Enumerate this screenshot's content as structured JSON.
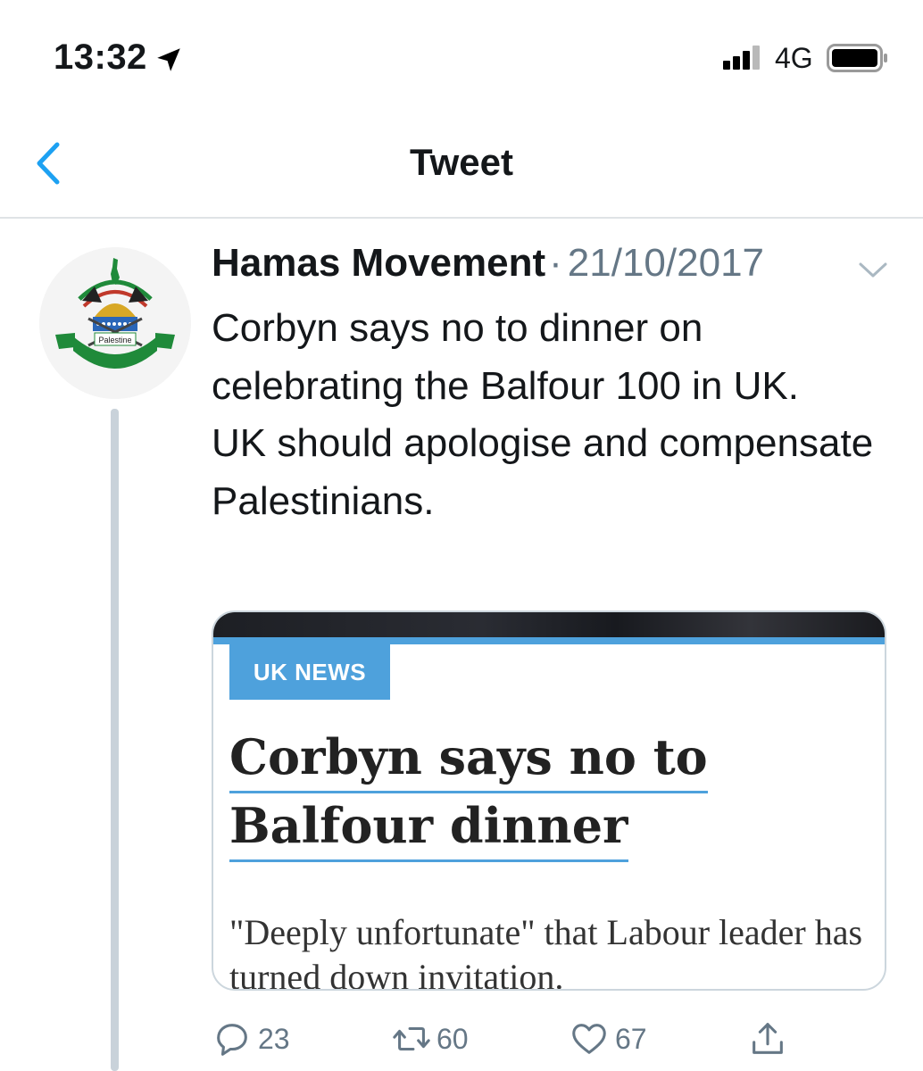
{
  "status_bar": {
    "time": "13:32",
    "network": "4G",
    "icons": [
      "location-arrow-icon",
      "signal-bars-icon",
      "battery-icon"
    ]
  },
  "nav": {
    "title": "Tweet",
    "back_icon": "chevron-left-icon"
  },
  "tweet": {
    "author": "Hamas Movement",
    "separator": "·",
    "date": "21/10/2017",
    "text_lines": [
      "Corbyn says no to dinner on celebrating the Balfour 100 in UK.",
      "UK should apologise and compensate Palestinians."
    ],
    "avatar_label": "Palestine",
    "card": {
      "label": "UK NEWS",
      "headline_lines": [
        "Corbyn says no to",
        "Balfour dinner"
      ],
      "summary": "\"Deeply unfortunate\" that Labour leader has turned down invitation."
    },
    "actions": {
      "replies": "23",
      "retweets": "60",
      "likes": "67"
    }
  },
  "colors": {
    "accent": "#1da1f2",
    "muted": "#657786",
    "card_blue": "#4ea1dc",
    "avatar_green": "#1f8a3a"
  }
}
